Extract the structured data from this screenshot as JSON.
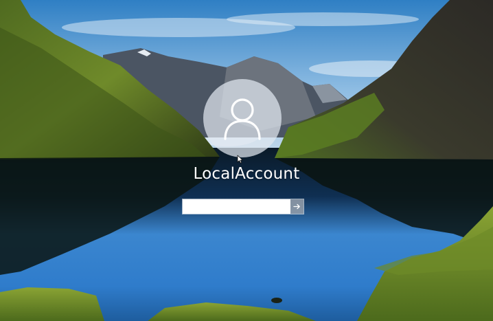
{
  "lock_screen": {
    "account_name": "LocalAccount",
    "password_placeholder": "",
    "avatar_icon": "user-silhouette-icon",
    "submit_icon": "arrow-right-icon"
  },
  "colors": {
    "avatar_fill": "#e1e8f0",
    "username_text": "#ffffff",
    "input_background": "#ffffff",
    "submit_button": "#96a0ac"
  }
}
